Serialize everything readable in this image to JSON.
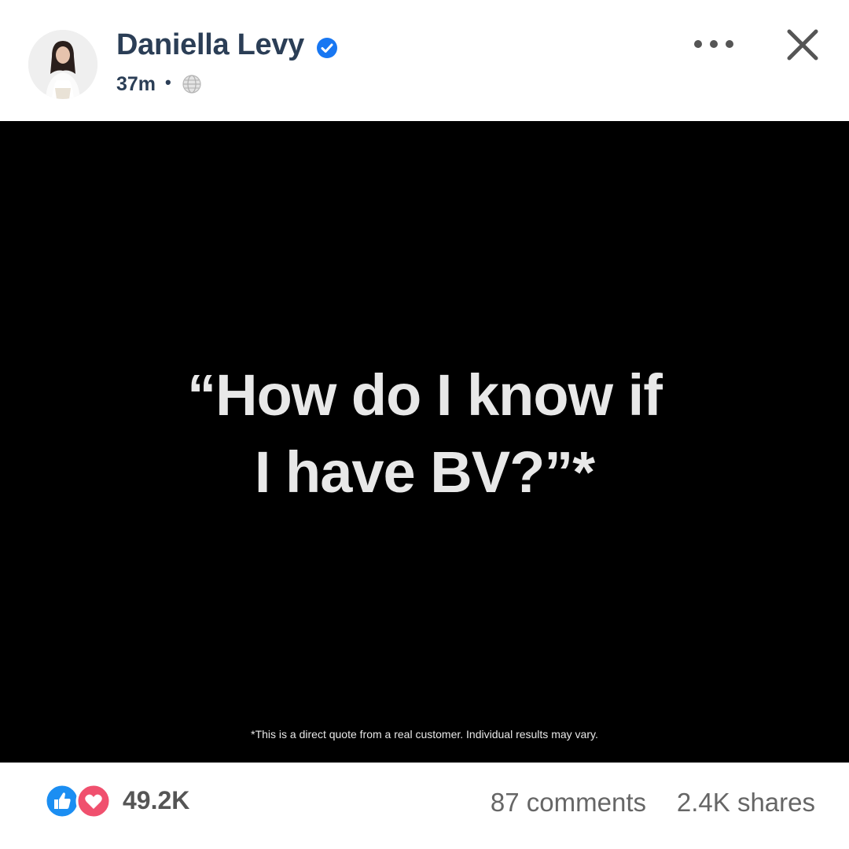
{
  "post": {
    "author": {
      "name": "Daniella Levy",
      "verified_icon": "verified-badge-icon",
      "avatar_icon": "profile-photo"
    },
    "timestamp": "37m",
    "separator": "•",
    "audience_icon": "globe-icon",
    "header_actions": {
      "more_icon": "more-horizontal-icon",
      "close_icon": "close-icon"
    },
    "media": {
      "quote_line1": "“How do I know if",
      "quote_line2": "I have BV?”*",
      "disclaimer": "*This is a direct quote from a real customer. Individual results may vary."
    },
    "engagement": {
      "reaction_icons": [
        "like-icon",
        "love-icon"
      ],
      "reactions": "49.2K",
      "comments": "87 comments",
      "shares": "2.4K shares"
    }
  },
  "colors": {
    "author_text": "#2b3e56",
    "verified_blue": "#1877f2",
    "like_blue": "#1b8ef2",
    "love_red": "#f0506e",
    "media_background": "#000000",
    "quote_text": "#e8e8e8",
    "meta_gray": "#666666"
  }
}
